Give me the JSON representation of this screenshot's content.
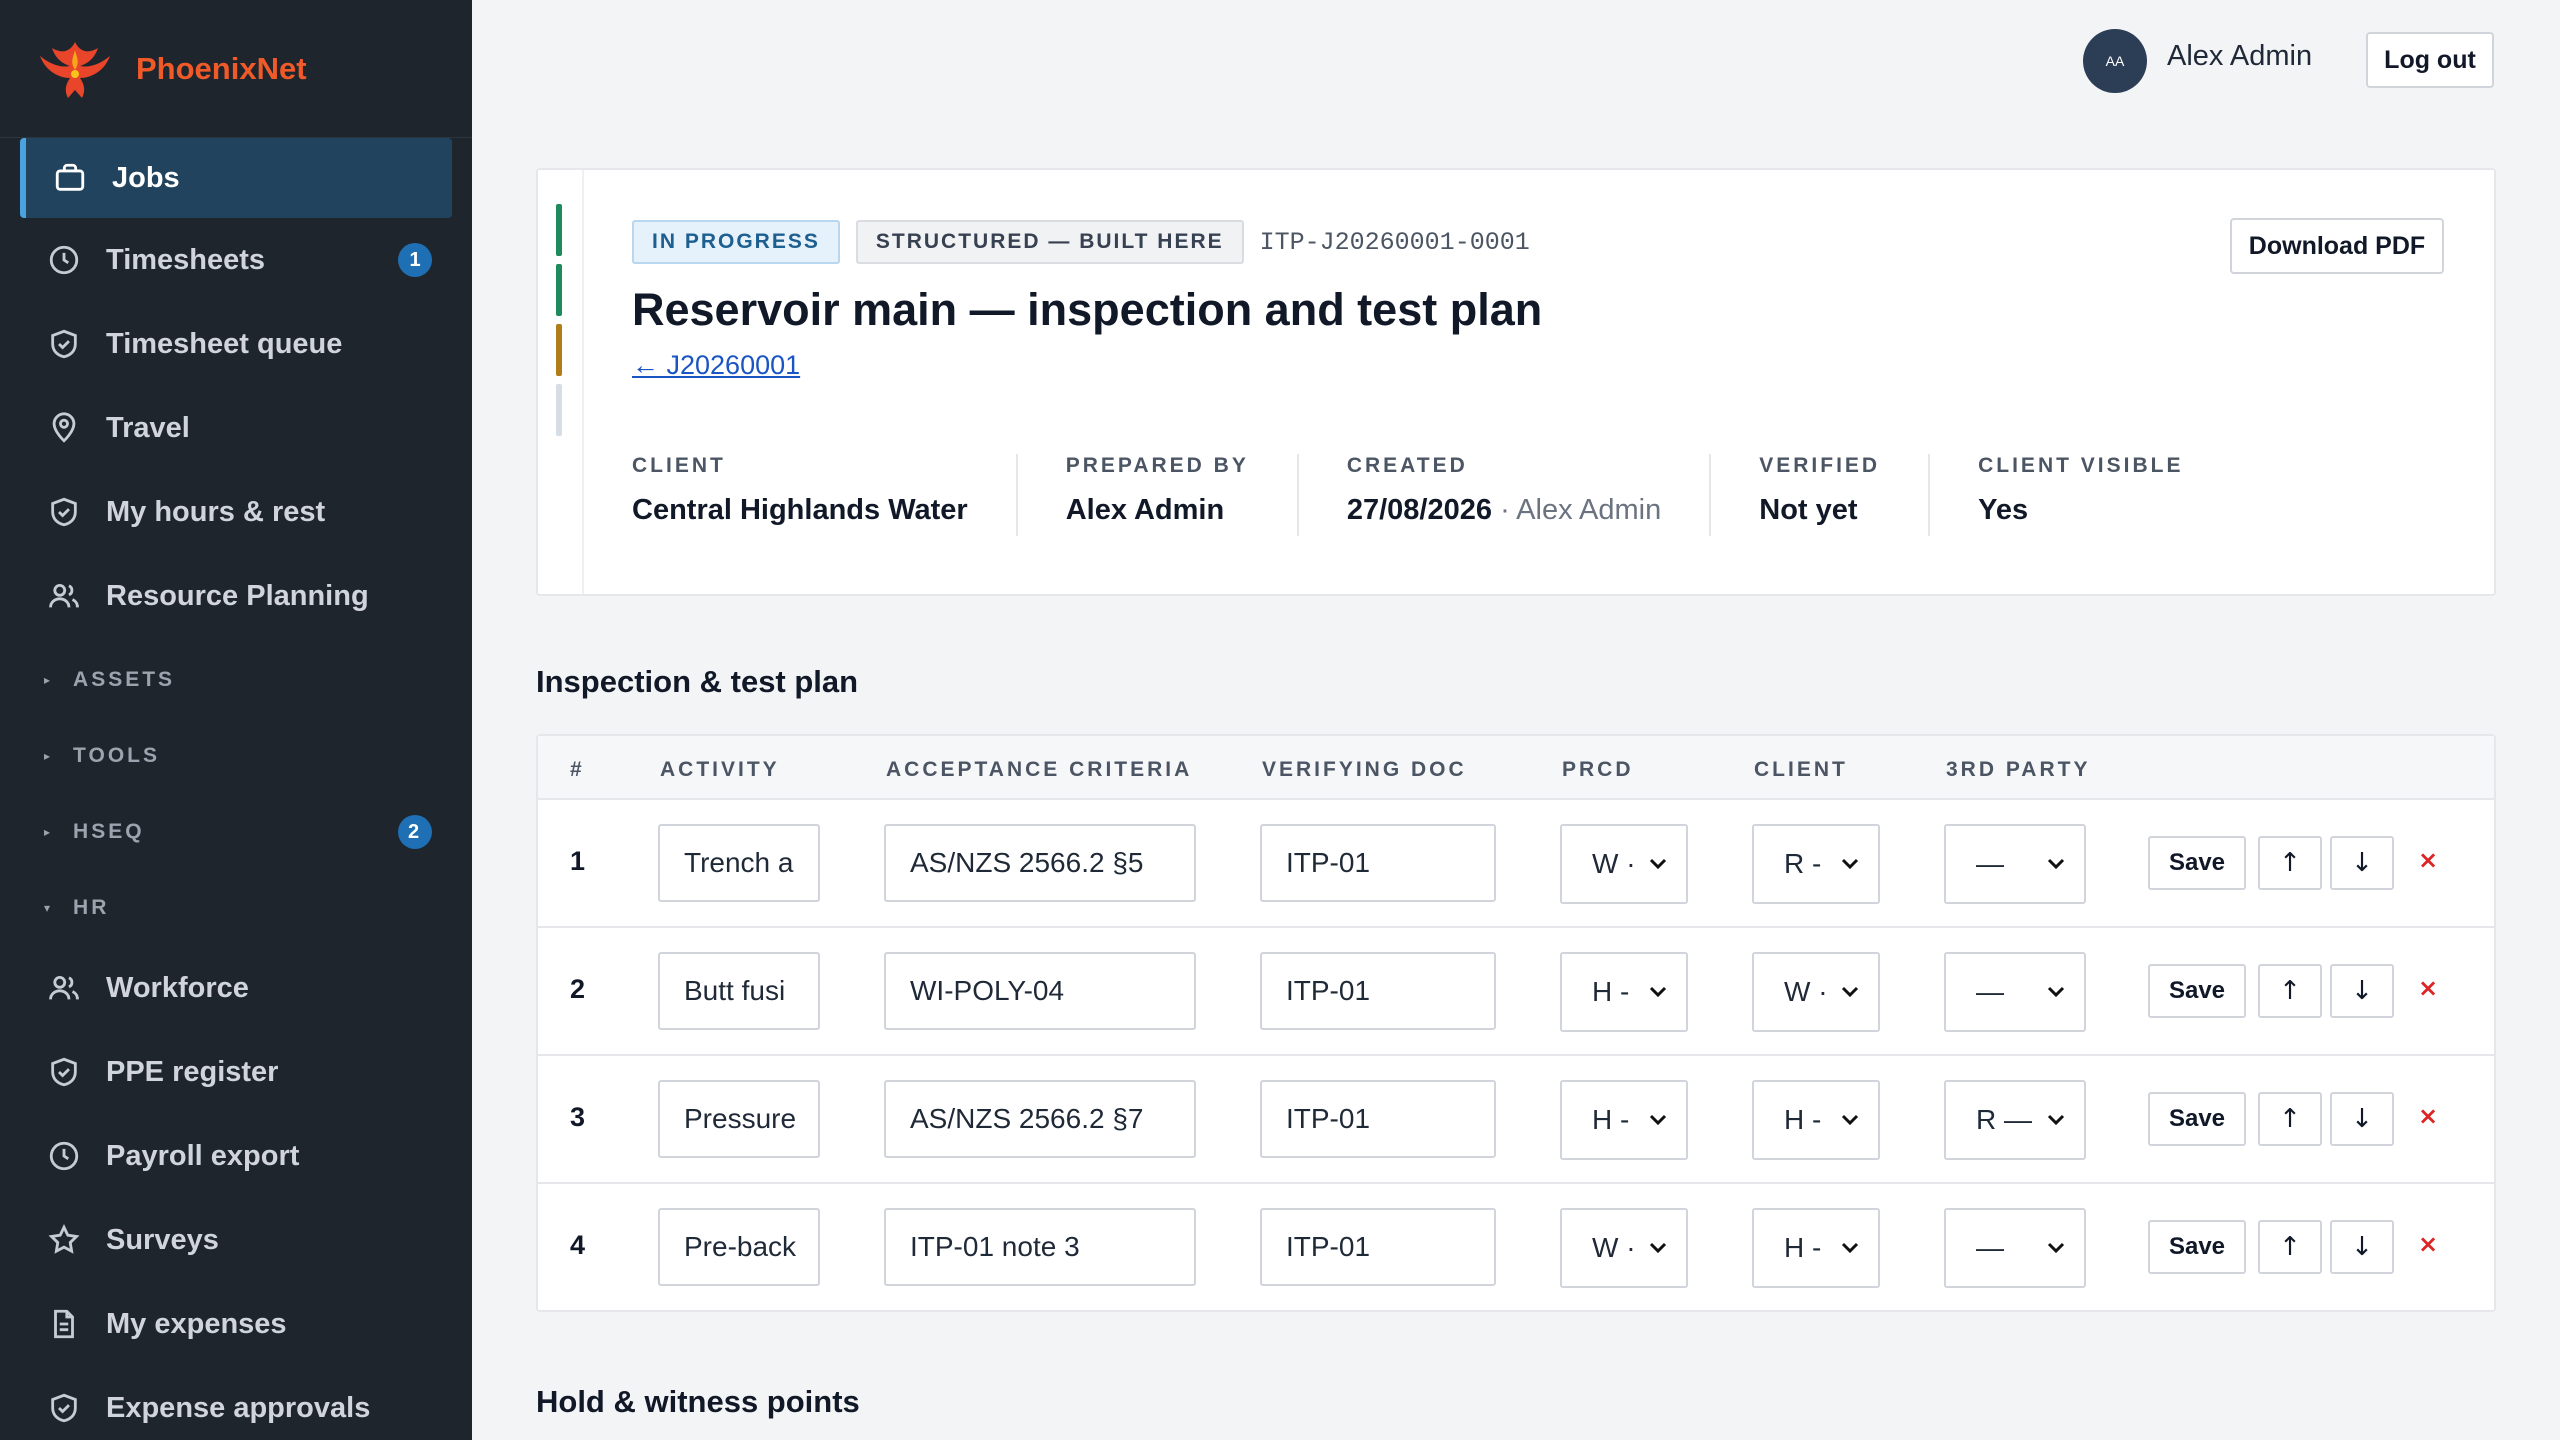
{
  "brand": {
    "name": "PhoenixNet"
  },
  "sidebar": {
    "items": [
      {
        "label": "Jobs",
        "icon": "briefcase-icon",
        "active": true
      },
      {
        "label": "Timesheets",
        "icon": "clock-icon",
        "badge": "1"
      },
      {
        "label": "Timesheet queue",
        "icon": "shield-check-icon"
      },
      {
        "label": "Travel",
        "icon": "map-pin-icon"
      },
      {
        "label": "My hours & rest",
        "icon": "shield-check-icon"
      },
      {
        "label": "Resource Planning",
        "icon": "users-icon"
      }
    ],
    "sections": {
      "assets": "ASSETS",
      "tools": "TOOLS",
      "hseq": "HSEQ",
      "hseq_badge": "2",
      "hr": "HR"
    },
    "hr_items": [
      {
        "label": "Workforce",
        "icon": "users-icon"
      },
      {
        "label": "PPE register",
        "icon": "shield-check-icon"
      },
      {
        "label": "Payroll export",
        "icon": "clock-icon"
      },
      {
        "label": "Surveys",
        "icon": "star-icon"
      },
      {
        "label": "My expenses",
        "icon": "document-icon"
      },
      {
        "label": "Expense approvals",
        "icon": "shield-check-icon"
      }
    ]
  },
  "topbar": {
    "avatar_initials": "AA",
    "user_name": "Alex Admin",
    "logout_label": "Log out"
  },
  "header": {
    "status": "IN PROGRESS",
    "type": "STRUCTURED — BUILT HERE",
    "doc_id": "ITP-J20260001-0001",
    "title": "Reservoir main — inspection and test plan",
    "back_link": "← J20260001",
    "download_label": "Download PDF",
    "stripe_colors": [
      "#1f8a5b",
      "#1f8a5b",
      "#b07d1a",
      "#d6dde6"
    ],
    "meta": {
      "client_label": "CLIENT",
      "client": "Central Highlands Water",
      "prepared_label": "PREPARED BY",
      "prepared": "Alex Admin",
      "created_label": "CREATED",
      "created_date": "27/08/2026",
      "created_by": "· Alex Admin",
      "verified_label": "VERIFIED",
      "verified": "Not yet",
      "visible_label": "CLIENT VISIBLE",
      "visible": "Yes"
    }
  },
  "itp": {
    "heading": "Inspection & test plan",
    "columns": {
      "num": "#",
      "activity": "ACTIVITY",
      "criteria": "ACCEPTANCE CRITERIA",
      "doc": "VERIFYING DOC",
      "prcd": "PRCD",
      "client": "CLIENT",
      "third": "3RD PARTY"
    },
    "save_label": "Save",
    "up_label": "↑",
    "down_label": "↓",
    "delete_label": "×",
    "rows": [
      {
        "num": "1",
        "activity": "Trench a",
        "criteria": "AS/NZS 2566.2 §5",
        "doc": "ITP-01",
        "prcd": "W ·",
        "client": "R -",
        "third": "—"
      },
      {
        "num": "2",
        "activity": "Butt fusi",
        "criteria": "WI-POLY-04",
        "doc": "ITP-01",
        "prcd": "H -",
        "client": "W ·",
        "third": "—"
      },
      {
        "num": "3",
        "activity": "Pressure",
        "criteria": "AS/NZS 2566.2 §7",
        "doc": "ITP-01",
        "prcd": "H -",
        "client": "H -",
        "third": "R —"
      },
      {
        "num": "4",
        "activity": "Pre-back",
        "criteria": "ITP-01 note 3",
        "doc": "ITP-01",
        "prcd": "W ·",
        "client": "H -",
        "third": "—"
      }
    ]
  },
  "hold_points": {
    "heading": "Hold & witness points"
  }
}
